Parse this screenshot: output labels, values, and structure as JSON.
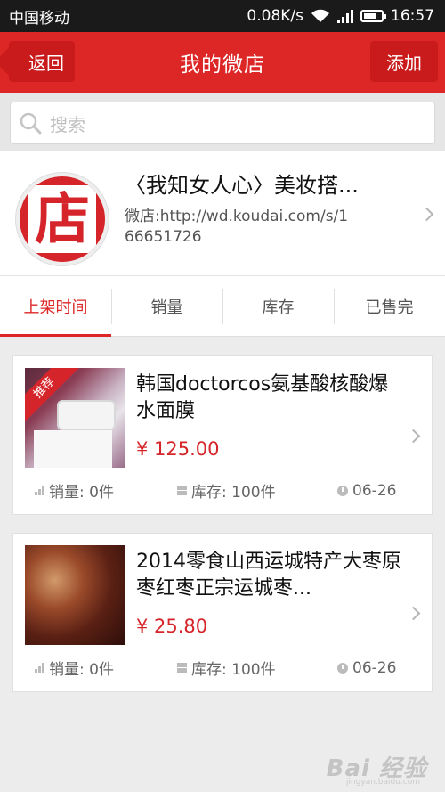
{
  "status_bar": {
    "carrier": "中国移动",
    "speed": "0.08K/s",
    "time": "16:57",
    "battery_level": 0.7
  },
  "header": {
    "back_label": "返回",
    "title": "我的微店",
    "add_label": "添加",
    "accent_color": "#dd2727"
  },
  "search": {
    "placeholder": "搜索"
  },
  "shop": {
    "logo_char": "店",
    "name": "〈我知女人心〉美妆搭...",
    "url": "微店:http://wd.koudai.com/s/166651726"
  },
  "tabs": [
    {
      "label": "上架时间",
      "active": true
    },
    {
      "label": "销量",
      "active": false
    },
    {
      "label": "库存",
      "active": false
    },
    {
      "label": "已售完",
      "active": false
    }
  ],
  "products": [
    {
      "title": "韩国doctorcos氨基酸核酸爆水面膜",
      "price": "¥ 125.00",
      "badge": "推荐",
      "sales": "销量: 0件",
      "stock": "库存: 100件",
      "date": "06-26"
    },
    {
      "title": "2014零食山西运城特产大枣原枣红枣正宗运城枣...",
      "price": "¥ 25.80",
      "sales": "销量: 0件",
      "stock": "库存: 100件",
      "date": "06-26"
    }
  ],
  "watermark": {
    "text": "Bai 经验",
    "sub": "jingyan.baidu.com"
  }
}
